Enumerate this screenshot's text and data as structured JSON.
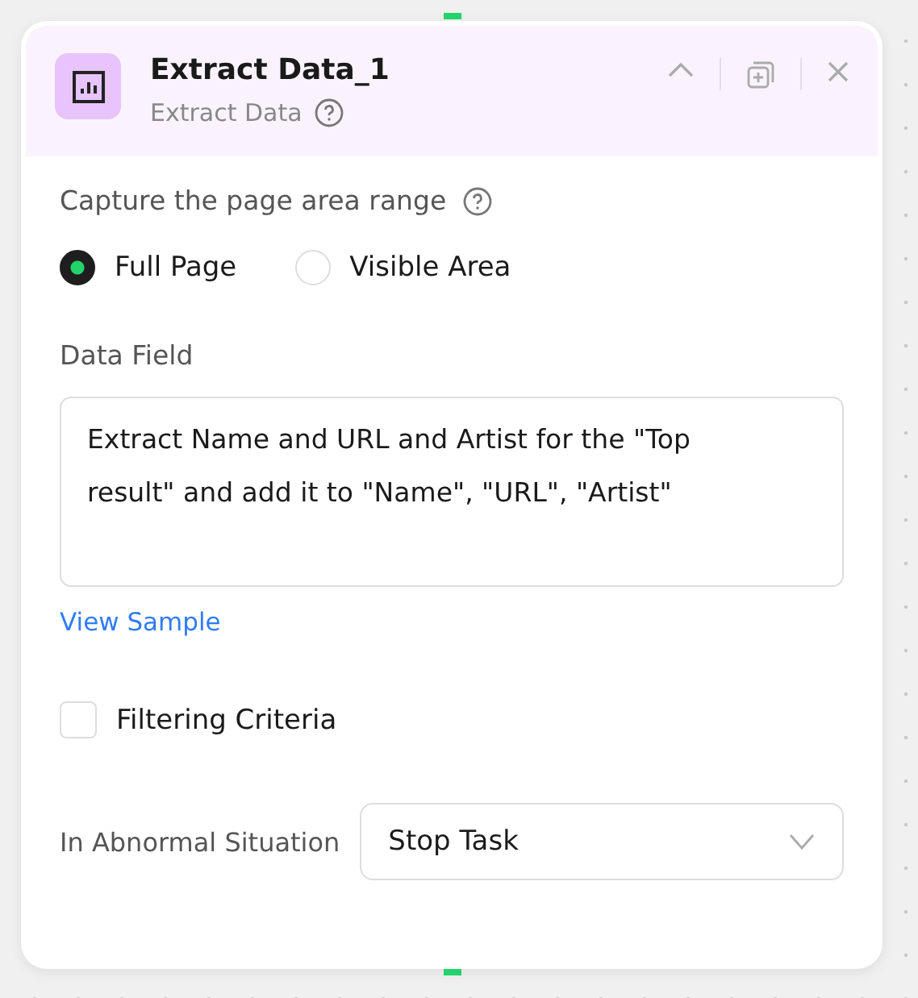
{
  "node": {
    "title": "Extract Data_1",
    "subtitle": "Extract Data"
  },
  "capture": {
    "label": "Capture the page area range",
    "options": [
      {
        "label": "Full Page",
        "selected": true
      },
      {
        "label": "Visible Area",
        "selected": false
      }
    ]
  },
  "data_field": {
    "label": "Data Field",
    "value": "Extract Name and URL and Artist for the \"Top result\" and add it to \"Name\", \"URL\", \"Artist\""
  },
  "view_sample": "View Sample",
  "filtering": {
    "label": "Filtering Criteria",
    "checked": false
  },
  "abnormal": {
    "label": "In Abnormal Situation",
    "value": "Stop Task"
  }
}
